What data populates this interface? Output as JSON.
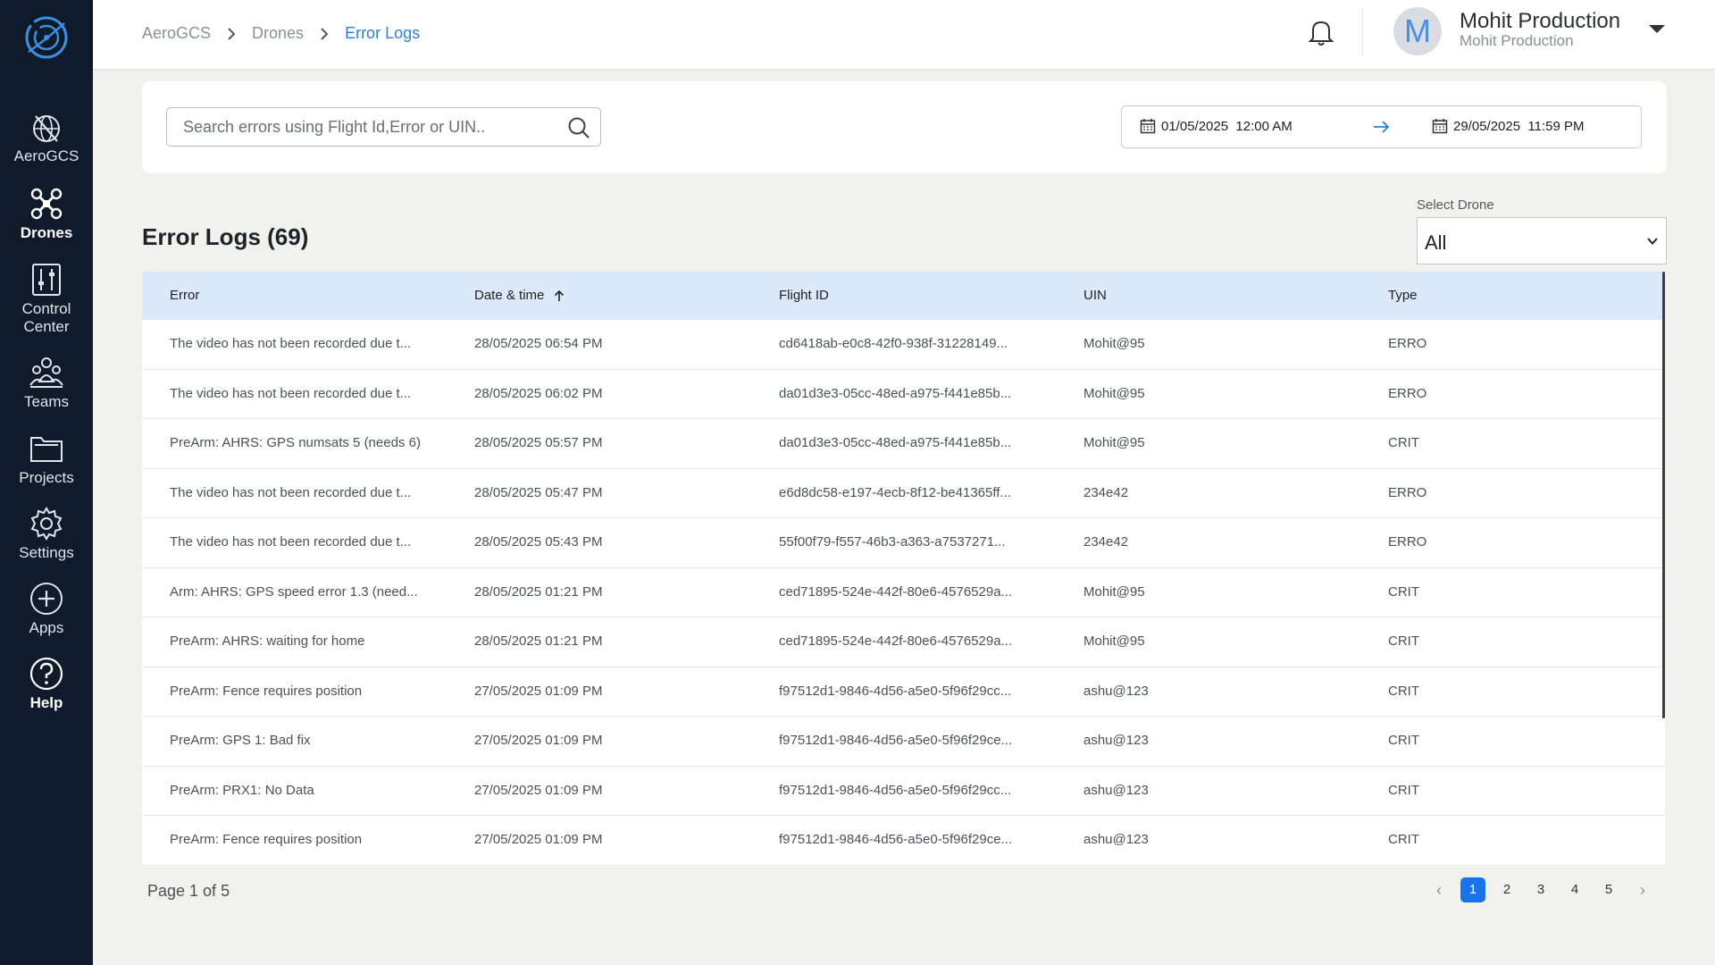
{
  "sidebar": {
    "items": [
      {
        "label": "AeroGCS"
      },
      {
        "label": "Drones"
      },
      {
        "label": "Control Center"
      },
      {
        "label": "Teams"
      },
      {
        "label": "Projects"
      },
      {
        "label": "Settings"
      },
      {
        "label": "Apps"
      },
      {
        "label": "Help"
      }
    ],
    "active": "Drones",
    "bg_color": "#0f1a2b"
  },
  "breadcrumb": [
    "AeroGCS",
    "Drones",
    "Error Logs"
  ],
  "user": {
    "initial": "M",
    "name": "Mohit Production",
    "org": "Mohit Production"
  },
  "search": {
    "placeholder": "Search errors using Flight Id,Error or UIN..",
    "value": ""
  },
  "date_range": {
    "start": "01/05/2025  12:00 AM",
    "end": "29/05/2025  11:59 PM"
  },
  "page_title": "Error Logs (69)",
  "drone_select": {
    "label": "Select Drone",
    "value": "All"
  },
  "table": {
    "columns": [
      "Error",
      "Date & time",
      "Flight ID",
      "UIN",
      "Type"
    ],
    "sort": {
      "column": "Date & time",
      "direction": "asc"
    },
    "rows": [
      [
        "The video has not been recorded due t...",
        "28/05/2025 06:54 PM",
        "cd6418ab-e0c8-42f0-938f-31228149...",
        "Mohit@95",
        "ERRO"
      ],
      [
        "The video has not been recorded due t...",
        "28/05/2025 06:02 PM",
        "da01d3e3-05cc-48ed-a975-f441e85b...",
        "Mohit@95",
        "ERRO"
      ],
      [
        "PreArm: AHRS: GPS numsats 5 (needs 6)",
        "28/05/2025 05:57 PM",
        "da01d3e3-05cc-48ed-a975-f441e85b...",
        "Mohit@95",
        "CRIT"
      ],
      [
        "The video has not been recorded due t...",
        "28/05/2025 05:47 PM",
        "e6d8dc58-e197-4ecb-8f12-be41365ff...",
        "234e42",
        "ERRO"
      ],
      [
        "The video has not been recorded due t...",
        "28/05/2025 05:43 PM",
        "55f00f79-f557-46b3-a363-a7537271...",
        "234e42",
        "ERRO"
      ],
      [
        "Arm: AHRS: GPS speed error 1.3 (need...",
        "28/05/2025 01:21 PM",
        "ced71895-524e-442f-80e6-4576529a...",
        "Mohit@95",
        "CRIT"
      ],
      [
        "PreArm: AHRS: waiting for home",
        "28/05/2025 01:21 PM",
        "ced71895-524e-442f-80e6-4576529a...",
        "Mohit@95",
        "CRIT"
      ],
      [
        "PreArm: Fence requires position",
        "27/05/2025 01:09 PM",
        "f97512d1-9846-4d56-a5e0-5f96f29cc...",
        "ashu@123",
        "CRIT"
      ],
      [
        "PreArm: GPS 1: Bad fix",
        "27/05/2025 01:09 PM",
        "f97512d1-9846-4d56-a5e0-5f96f29ce...",
        "ashu@123",
        "CRIT"
      ],
      [
        "PreArm: PRX1: No Data",
        "27/05/2025 01:09 PM",
        "f97512d1-9846-4d56-a5e0-5f96f29cc...",
        "ashu@123",
        "CRIT"
      ],
      [
        "PreArm: Fence requires position",
        "27/05/2025 01:09 PM",
        "f97512d1-9846-4d56-a5e0-5f96f29ce...",
        "ashu@123",
        "CRIT"
      ]
    ]
  },
  "pagination": {
    "info": "Page 1 of 5",
    "pages": [
      "1",
      "2",
      "3",
      "4",
      "5"
    ],
    "current": "1",
    "prev": "‹",
    "next": "›"
  },
  "colors": {
    "accent": "#1a73e8",
    "header_row": "#dbe9fb",
    "breadcrumb_active": "#2f80d8"
  }
}
